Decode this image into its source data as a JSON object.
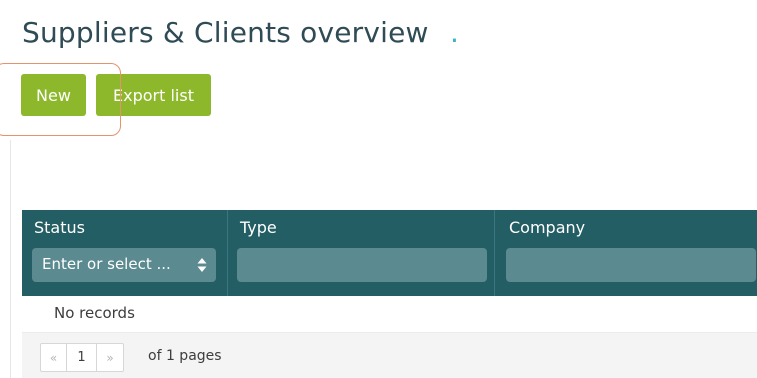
{
  "page": {
    "title": "Suppliers & Clients overview",
    "title_dot": "."
  },
  "toolbar": {
    "new_label": "New",
    "export_label": "Export list"
  },
  "table": {
    "columns": [
      {
        "label": "Status",
        "filter_placeholder": "Enter or select ..."
      },
      {
        "label": "Type",
        "filter_placeholder": ""
      },
      {
        "label": "Company",
        "filter_placeholder": ""
      }
    ],
    "empty_message": "No records"
  },
  "pager": {
    "prev_icon": "«",
    "current_page": "1",
    "next_icon": "»",
    "of_pages": "of 1 pages"
  },
  "colors": {
    "title": "#2f4b55",
    "accent_dot": "#3bb3c3",
    "button": "#8db82b",
    "table_header": "#245e65",
    "filter_field": "#5b8a90",
    "highlight": "#e6926d"
  },
  "icons": {
    "sort": "sort-icon",
    "prev": "double-chevron-left-icon",
    "next": "double-chevron-right-icon"
  }
}
